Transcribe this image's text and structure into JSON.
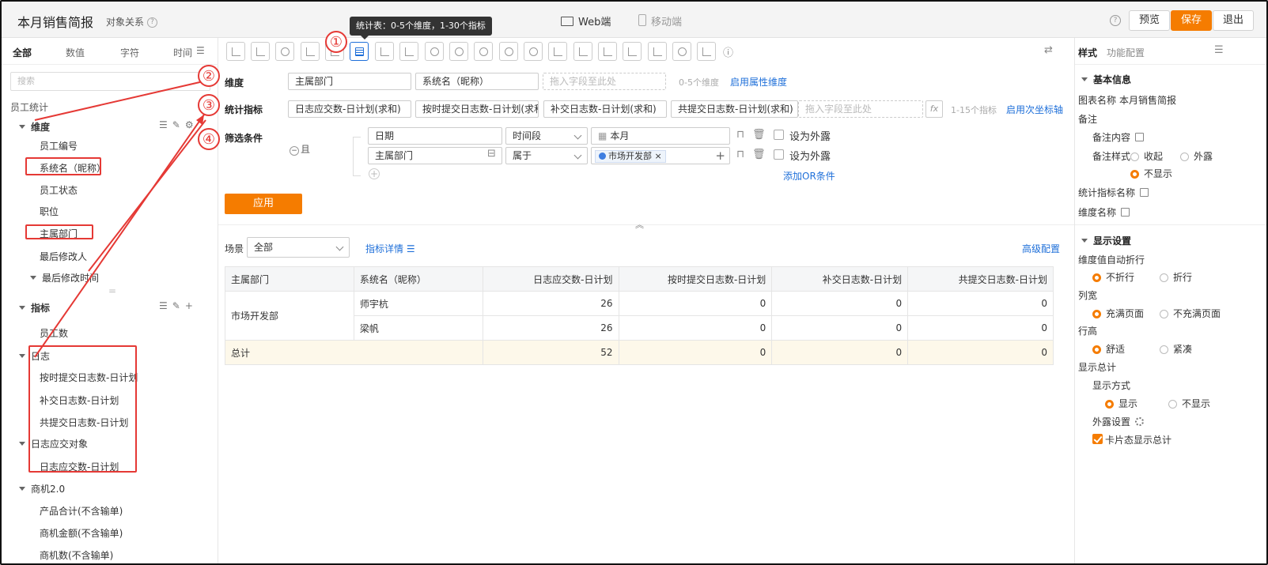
{
  "header": {
    "title": "本月销售简报",
    "object_relation": "对象关系",
    "web_mode": "Web端",
    "mobile_mode": "移动端",
    "preview": "预览",
    "save": "保存",
    "exit": "退出"
  },
  "left_panel": {
    "tabs": [
      "全部",
      "数值",
      "字符",
      "时间"
    ],
    "search_placeholder": "搜索",
    "object": "员工统计",
    "dimension_group": "维度",
    "dimensions": [
      "员工编号",
      "系统名（昵称）",
      "员工状态",
      "职位",
      "主属部门",
      "最后修改人",
      "最后修改时间"
    ],
    "metric_group": "指标",
    "metric_top": "员工数",
    "log_group": "日志",
    "log_items": [
      "按时提交日志数-日计划",
      "补交日志数-日计划",
      "共提交日志数-日计划"
    ],
    "log_obj_group": "日志应交对象",
    "log_obj_items": [
      "日志应交数-日计划"
    ],
    "opp_group": "商机2.0",
    "opp_items": [
      "产品合计(不含输单)",
      "商机金额(不含输单)",
      "商机数(不含输单)"
    ]
  },
  "toolbar": {
    "tooltip": "统计表：0-5个维度，1-30个指标"
  },
  "config": {
    "dimension_label": "维度",
    "dimension_pills": [
      "主属部门",
      "系统名（昵称）"
    ],
    "drop_placeholder": "拖入字段至此处",
    "dim_hint": "0-5个维度",
    "dim_link": "启用属性维度",
    "metric_label": "统计指标",
    "metric_pills": [
      "日志应交数-日计划(求和)",
      "按时提交日志数-日计划(求和)",
      "补交日志数-日计划(求和)",
      "共提交日志数-日计划(求和)"
    ],
    "metric_hint": "1-15个指标",
    "metric_link": "启用次坐标轴",
    "fx": "fx",
    "filter_label": "筛选条件",
    "logic": "且",
    "filters": [
      {
        "field": "日期",
        "op": "时间段",
        "value": "本月",
        "expose": "设为外露"
      },
      {
        "field": "主属部门",
        "op": "属于",
        "value": "市场开发部",
        "expose": "设为外露"
      }
    ],
    "add_or": "添加OR条件",
    "apply": "应用"
  },
  "results": {
    "scene_label": "场景",
    "scene_value": "全部",
    "metric_detail": "指标详情",
    "advanced": "高级配置",
    "columns": [
      "主属部门",
      "系统名（昵称）",
      "日志应交数-日计划",
      "按时提交日志数-日计划",
      "补交日志数-日计划",
      "共提交日志数-日计划"
    ],
    "group_dept": "市场开发部",
    "rows": [
      {
        "name": "师宇杭",
        "values": [
          "26",
          "0",
          "0",
          "0"
        ]
      },
      {
        "name": "梁帆",
        "values": [
          "26",
          "0",
          "0",
          "0"
        ]
      }
    ],
    "total_label": "总计",
    "total_values": [
      "52",
      "0",
      "0",
      "0"
    ]
  },
  "right_panel": {
    "tabs": [
      "样式",
      "功能配置"
    ],
    "basic_info": "基本信息",
    "chart_name_label": "图表名称",
    "chart_name_value": "本月销售简报",
    "remark": "备注",
    "remark_content": "备注内容",
    "remark_style": "备注样式",
    "remark_opts": [
      "收起",
      "外露",
      "不显示"
    ],
    "metric_name": "统计指标名称",
    "dim_name": "维度名称",
    "display": "显示设置",
    "wrap_label": "维度值自动折行",
    "wrap_opts": [
      "不折行",
      "折行"
    ],
    "width_label": "列宽",
    "width_opts": [
      "充满页面",
      "不充满页面"
    ],
    "height_label": "行高",
    "height_opts": [
      "舒适",
      "紧凑"
    ],
    "total_label": "显示总计",
    "total_mode": "显示方式",
    "total_opts": [
      "显示",
      "不显示"
    ],
    "expose_settings": "外露设置",
    "card_total": "卡片态显示总计"
  },
  "annotations": [
    "①",
    "②",
    "③",
    "④"
  ],
  "colors": {
    "accent": "#f57c00",
    "link": "#1e6fd9",
    "annotation": "#e53935"
  }
}
